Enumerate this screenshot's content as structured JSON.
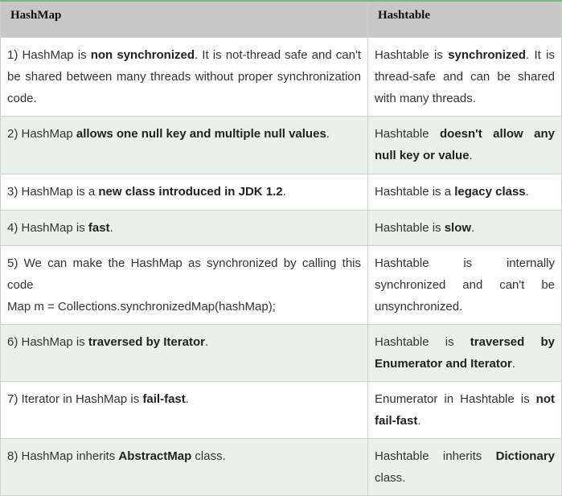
{
  "table": {
    "headers": [
      "HashMap",
      "Hashtable"
    ],
    "rows": [
      {
        "left": [
          {
            "t": "1) HashMap is "
          },
          {
            "t": "non synchronized",
            "b": true
          },
          {
            "t": ". It is not-thread safe and can't be shared between many threads without proper synchronization code."
          }
        ],
        "right": [
          {
            "t": "Hashtable is "
          },
          {
            "t": "synchronized",
            "b": true
          },
          {
            "t": ". It is thread-safe and can be shared with many threads."
          }
        ]
      },
      {
        "left": [
          {
            "t": "2) HashMap "
          },
          {
            "t": "allows one null key and multiple null values",
            "b": true
          },
          {
            "t": "."
          }
        ],
        "right": [
          {
            "t": "Hashtable "
          },
          {
            "t": "doesn't allow any null key or value",
            "b": true
          },
          {
            "t": "."
          }
        ]
      },
      {
        "left": [
          {
            "t": "3) HashMap is a "
          },
          {
            "t": "new class introduced in JDK 1.2",
            "b": true
          },
          {
            "t": "."
          }
        ],
        "right": [
          {
            "t": "Hashtable is a "
          },
          {
            "t": "legacy class",
            "b": true
          },
          {
            "t": "."
          }
        ]
      },
      {
        "left": [
          {
            "t": "4) HashMap is "
          },
          {
            "t": "fast",
            "b": true
          },
          {
            "t": "."
          }
        ],
        "right": [
          {
            "t": "Hashtable is "
          },
          {
            "t": "slow",
            "b": true
          },
          {
            "t": "."
          }
        ]
      },
      {
        "left": [
          {
            "t": "5) We can make the HashMap as synchronized by calling this code"
          },
          {
            "br": true
          },
          {
            "t": "Map m = Collections.synchronizedMap(hashMap);"
          }
        ],
        "right": [
          {
            "t": "Hashtable is internally synchronized and can't be unsynchronized."
          }
        ]
      },
      {
        "left": [
          {
            "t": "6) HashMap is "
          },
          {
            "t": "traversed by Iterator",
            "b": true
          },
          {
            "t": "."
          }
        ],
        "right": [
          {
            "t": "Hashtable is "
          },
          {
            "t": "traversed by Enumerator and Iterator",
            "b": true
          },
          {
            "t": "."
          }
        ]
      },
      {
        "left": [
          {
            "t": "7) Iterator in HashMap is "
          },
          {
            "t": "fail-fast",
            "b": true
          },
          {
            "t": "."
          }
        ],
        "right": [
          {
            "t": "Enumerator in Hashtable is "
          },
          {
            "t": "not fail-fast",
            "b": true
          },
          {
            "t": "."
          }
        ]
      },
      {
        "left": [
          {
            "t": "8) HashMap inherits "
          },
          {
            "t": "AbstractMap",
            "b": true
          },
          {
            "t": " class."
          }
        ],
        "right": [
          {
            "t": "Hashtable inherits "
          },
          {
            "t": "Dictionary",
            "b": true
          },
          {
            "t": " class."
          }
        ]
      }
    ]
  }
}
